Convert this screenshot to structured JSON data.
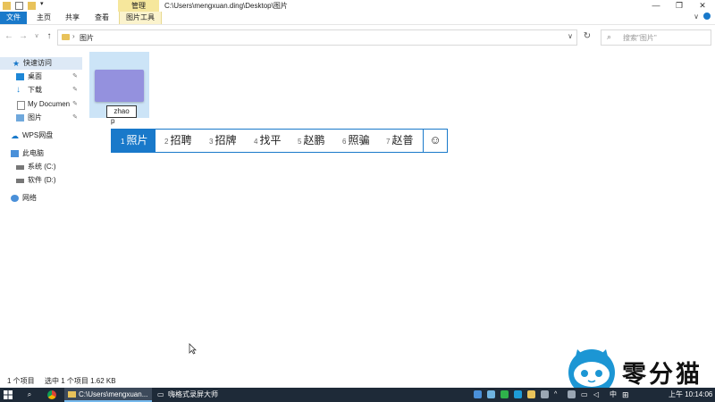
{
  "window": {
    "title": "C:\\Users\\mengxuan.ding\\Desktop\\图片",
    "manage_tab": "管理",
    "buttons": {
      "minimize": "—",
      "maximize": "❐",
      "close": "✕"
    }
  },
  "ribbon": {
    "tabs": [
      "文件",
      "主页",
      "共享",
      "查看",
      "图片工具"
    ]
  },
  "address": {
    "path": "图片",
    "search_placeholder": "搜索\"图片\""
  },
  "nav": {
    "quick_access": "快速访问",
    "pinned": [
      {
        "label": "桌面",
        "icon": "desktop-icon"
      },
      {
        "label": "下载",
        "icon": "download-icon"
      },
      {
        "label": "My Documen",
        "icon": "documents-icon"
      },
      {
        "label": "图片",
        "icon": "pictures-icon"
      }
    ],
    "wps": "WPS网盘",
    "this_pc": "此电脑",
    "drives": [
      "系统 (C:)",
      "软件 (D:)"
    ],
    "network": "网络"
  },
  "content": {
    "rename_value": "zhao",
    "ime_composition": "p",
    "candidates": [
      {
        "n": "1",
        "text": "照片"
      },
      {
        "n": "2",
        "text": "招聘"
      },
      {
        "n": "3",
        "text": "招牌"
      },
      {
        "n": "4",
        "text": "找平"
      },
      {
        "n": "5",
        "text": "赵鹏"
      },
      {
        "n": "6",
        "text": "照骗"
      },
      {
        "n": "7",
        "text": "赵普"
      }
    ],
    "emoji": "☺"
  },
  "status": {
    "count": "1 个项目",
    "selected": "选中 1 个项目  1.62 KB"
  },
  "watermark": "零分猫",
  "taskbar": {
    "explorer": "C:\\Users\\mengxuan...",
    "recorder": "嗨格式录屏大师",
    "ime": "中",
    "time": "上午 10:14:06"
  },
  "colors": {
    "accent": "#1979ca",
    "thumb": "#9491de",
    "selection": "#cce4f7"
  }
}
